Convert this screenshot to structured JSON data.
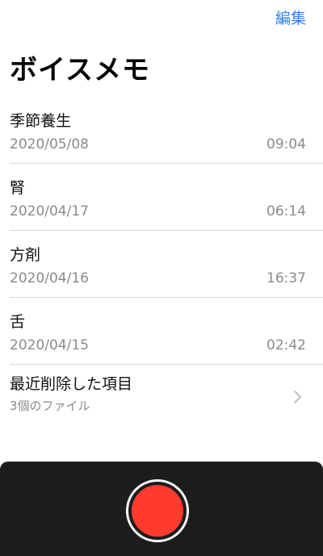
{
  "header": {
    "edit_label": "編集",
    "title": "ボイスメモ"
  },
  "recordings": [
    {
      "title": "季節養生",
      "date": "2020/05/08",
      "duration": "09:04"
    },
    {
      "title": "腎",
      "date": "2020/04/17",
      "duration": "06:14"
    },
    {
      "title": "方剤",
      "date": "2020/04/16",
      "duration": "16:37"
    },
    {
      "title": "舌",
      "date": "2020/04/15",
      "duration": "02:42"
    }
  ],
  "recently_deleted": {
    "title": "最近削除した項目",
    "count_text": "3個のファイル"
  },
  "colors": {
    "accent": "#2f80ed",
    "record": "#ff3b30",
    "panel": "#1d1d1f",
    "secondary_text": "#8a8a8e"
  },
  "icons": {
    "chevron": "chevron-right-icon",
    "record": "record-icon"
  }
}
